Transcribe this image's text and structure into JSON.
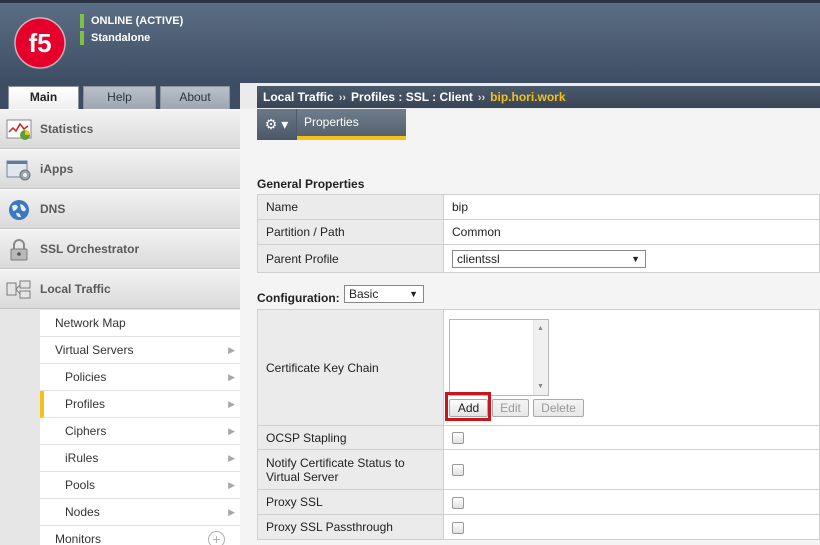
{
  "header": {
    "status_line_1": "ONLINE (ACTIVE)",
    "status_line_2": "Standalone",
    "logo_text": "f5",
    "brand_color": "#e4002b"
  },
  "tabs": [
    {
      "label": "Main"
    },
    {
      "label": "Help"
    },
    {
      "label": "About"
    }
  ],
  "sidebar": {
    "sections": [
      {
        "label": "Statistics",
        "icon": "statistics-icon"
      },
      {
        "label": "iApps",
        "icon": "iapps-icon"
      },
      {
        "label": "DNS",
        "icon": "dns-globe-icon"
      },
      {
        "label": "SSL Orchestrator",
        "icon": "lock-icon"
      },
      {
        "label": "Local Traffic",
        "icon": "local-traffic-icon"
      }
    ],
    "sub_items": [
      {
        "label": "Network Map"
      },
      {
        "label": "Virtual Servers"
      },
      {
        "label": "Policies"
      },
      {
        "label": "Profiles"
      },
      {
        "label": "Ciphers"
      },
      {
        "label": "iRules"
      },
      {
        "label": "Pools"
      },
      {
        "label": "Nodes"
      },
      {
        "label": "Monitors"
      }
    ],
    "active_accent": "#f5c115"
  },
  "breadcrumb": {
    "part1": "Local Traffic",
    "part2": "Profiles : SSL : Client",
    "current": "bip.hori.work",
    "separator": "››"
  },
  "toolbar": {
    "gear_label": "⚙ ▾",
    "tab_properties": "Properties"
  },
  "general": {
    "title": "General Properties",
    "rows": [
      {
        "label": "Name",
        "value": "bip"
      },
      {
        "label": "Partition / Path",
        "value": "Common"
      },
      {
        "label": "Parent Profile",
        "value": "clientssl"
      }
    ]
  },
  "configuration": {
    "label": "Configuration:",
    "mode": "Basic",
    "rows": {
      "cert_key_chain": "Certificate Key Chain",
      "ocsp": "OCSP Stapling",
      "notify_line1": "Notify Certificate Status to",
      "notify_line2": "Virtual Server",
      "proxy_ssl": "Proxy SSL",
      "proxy_ssl_passthrough": "Proxy SSL Passthrough"
    },
    "buttons": {
      "add": "Add",
      "edit": "Edit",
      "delete": "Delete"
    }
  }
}
